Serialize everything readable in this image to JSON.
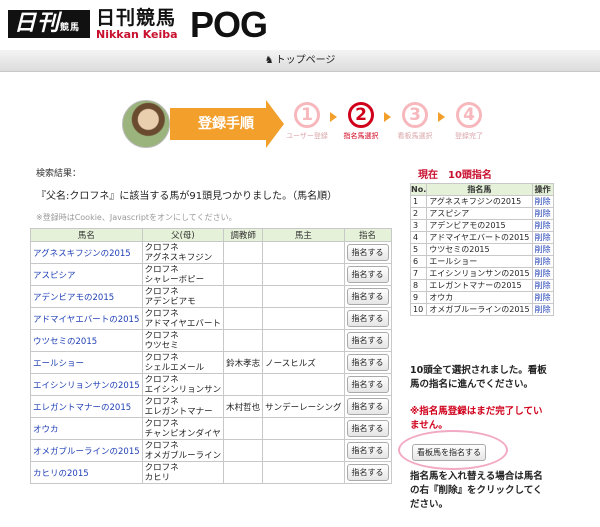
{
  "header": {
    "logo_nikkan": "日刊",
    "logo_nikkan_sub": "競馬",
    "logo_jp": "日刊競馬",
    "logo_en": "Nikkan Keiba",
    "logo_pog": "POG"
  },
  "nav": {
    "top_link": "トップページ"
  },
  "steps": {
    "title": "登録手順",
    "items": [
      {
        "num": "1",
        "label": "ユーザー登録",
        "active": false
      },
      {
        "num": "2",
        "label": "指名馬選択",
        "active": true
      },
      {
        "num": "3",
        "label": "看板馬選択",
        "active": false
      },
      {
        "num": "4",
        "label": "登録完了",
        "active": false
      }
    ]
  },
  "search": {
    "heading": "検索結果：",
    "message": "『父名:クロフネ』に該当する馬が91頭見つかりました。（馬名順）",
    "note": "※登録時はCookie、Javascriptをオンにしてください。"
  },
  "horses_table": {
    "headers": [
      "馬名",
      "父(母)",
      "調教師",
      "馬主",
      "指名"
    ],
    "button_label": "指名する",
    "rows": [
      {
        "name": "アグネスキフジンの2015",
        "sire": "クロフネ",
        "dam": "アグネスキフジン",
        "trainer": "",
        "owner": ""
      },
      {
        "name": "アスピシア",
        "sire": "クロフネ",
        "dam": "シャレーボピー",
        "trainer": "",
        "owner": ""
      },
      {
        "name": "アデンビアモの2015",
        "sire": "クロフネ",
        "dam": "アデンビアモ",
        "trainer": "",
        "owner": ""
      },
      {
        "name": "アドマイヤエバートの2015",
        "sire": "クロフネ",
        "dam": "アドマイヤエバート",
        "trainer": "",
        "owner": ""
      },
      {
        "name": "ウツセミの2015",
        "sire": "クロフネ",
        "dam": "ウツセミ",
        "trainer": "",
        "owner": ""
      },
      {
        "name": "エールショー",
        "sire": "クロフネ",
        "dam": "シェルエメール",
        "trainer": "鈴木孝志",
        "owner": "ノースヒルズ"
      },
      {
        "name": "エイシンリョンサンの2015",
        "sire": "クロフネ",
        "dam": "エイシンリョンサン",
        "trainer": "",
        "owner": ""
      },
      {
        "name": "エレガントマナーの2015",
        "sire": "クロフネ",
        "dam": "エレガントマナー",
        "trainer": "木村哲也",
        "owner": "サンデーレーシング"
      },
      {
        "name": "オウカ",
        "sire": "クロフネ",
        "dam": "チャンピオンダイヤ",
        "trainer": "",
        "owner": ""
      },
      {
        "name": "オメガブルーラインの2015",
        "sire": "クロフネ",
        "dam": "オメガブルーライン",
        "trainer": "",
        "owner": ""
      },
      {
        "name": "カヒリの2015",
        "sire": "クロフネ",
        "dam": "カヒリ",
        "trainer": "",
        "owner": ""
      }
    ]
  },
  "current": {
    "label": "現在　10頭指名",
    "headers": [
      "No.",
      "指名馬",
      "操作"
    ],
    "delete_label": "削除",
    "picks": [
      {
        "no": "1",
        "name": "アグネスキフジンの2015"
      },
      {
        "no": "2",
        "name": "アスピシア"
      },
      {
        "no": "3",
        "name": "アデンビアモの2015"
      },
      {
        "no": "4",
        "name": "アドマイヤエバートの2015"
      },
      {
        "no": "5",
        "name": "ウツセミの2015"
      },
      {
        "no": "6",
        "name": "エールショー"
      },
      {
        "no": "7",
        "name": "エイシンリョンサンの2015"
      },
      {
        "no": "8",
        "name": "エレガントマナーの2015"
      },
      {
        "no": "9",
        "name": "オウカ"
      },
      {
        "no": "10",
        "name": "オメガブルーラインの2015"
      }
    ]
  },
  "sidebar": {
    "done_msg": "10頭全て選択されました。看板馬の指名に進んでください。",
    "warn_msg": "※指名馬登録はまだ完了していません。",
    "kanban_button": "看板馬を指名する",
    "replace_msg": "指名馬を入れ替える場合は馬名の右『削除』をクリックしてください。"
  },
  "colors": {
    "accent": "#f29f2c",
    "active_step": "#d0001b",
    "link": "#1f3fb5",
    "header_bg": "#e5f1d8"
  }
}
